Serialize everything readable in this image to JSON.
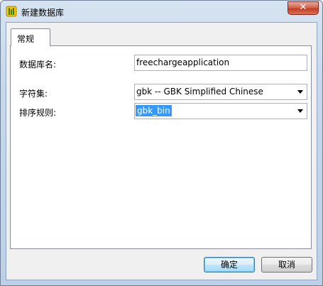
{
  "window": {
    "title": "新建数据库",
    "close_label": "✕"
  },
  "tabs": [
    {
      "label": "常规"
    }
  ],
  "form": {
    "db_name_label": "数据库名:",
    "db_name_value": "freechargeapplication",
    "charset_label": "字符集:",
    "charset_value": "gbk -- GBK Simplified Chinese",
    "collation_label": "排序规则:",
    "collation_value": "gbk_bin"
  },
  "buttons": {
    "ok": "确定",
    "cancel": "取消"
  },
  "colors": {
    "accent": "#3399ff",
    "title_bg": "#c7d8eb",
    "close_red": "#c13f23"
  }
}
